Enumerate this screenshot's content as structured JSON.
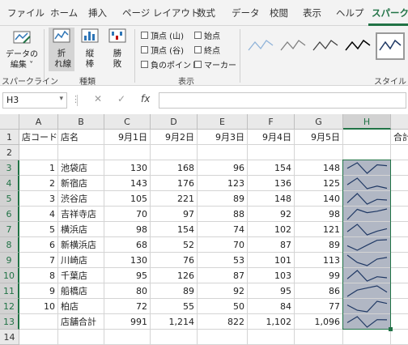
{
  "ribbon_tabs": [
    "ファイル",
    "ホーム",
    "挿入",
    "ページ レイアウト",
    "数式",
    "データ",
    "校閲",
    "表示",
    "ヘルプ",
    "スパークラ"
  ],
  "active_tab": "スパークラ",
  "ribbon": {
    "edit_data": "データの\n編集 ˅",
    "line": "折\n れ線",
    "column": "縦\n棒",
    "winloss": "勝\n敗",
    "group_sparkline": "スパークライン",
    "group_type": "種類",
    "group_show": "表示",
    "group_style": "スタイル",
    "checks": {
      "high": "頂点 (山)",
      "low": "頂点 (谷)",
      "negative": "負のポイント",
      "first": "始点",
      "last": "終点",
      "markers": "マーカー"
    }
  },
  "formula_bar": {
    "name_box": "H3",
    "fx": "fx",
    "value": ""
  },
  "col_headers": [
    "A",
    "B",
    "C",
    "D",
    "E",
    "F",
    "G",
    "H"
  ],
  "selected_col": "H",
  "row_headers": [
    "1",
    "2",
    "3",
    "4",
    "5",
    "6",
    "7",
    "8",
    "9",
    "10",
    "11",
    "12",
    "13",
    "14"
  ],
  "table": {
    "header": [
      "店コード",
      "店名",
      "9月1日",
      "9月2日",
      "9月3日",
      "9月4日",
      "9月5日",
      "",
      "合計"
    ],
    "rows": [
      {
        "code": "1",
        "name": "池袋店",
        "v": [
          "130",
          "168",
          "96",
          "154",
          "148"
        ]
      },
      {
        "code": "2",
        "name": "新宿店",
        "v": [
          "143",
          "176",
          "123",
          "136",
          "125"
        ]
      },
      {
        "code": "3",
        "name": "渋谷店",
        "v": [
          "105",
          "221",
          "89",
          "148",
          "140"
        ]
      },
      {
        "code": "4",
        "name": "吉祥寺店",
        "v": [
          "70",
          "97",
          "88",
          "92",
          "98"
        ]
      },
      {
        "code": "5",
        "name": "横浜店",
        "v": [
          "98",
          "154",
          "74",
          "102",
          "121"
        ]
      },
      {
        "code": "6",
        "name": "新横浜店",
        "v": [
          "68",
          "52",
          "70",
          "87",
          "89"
        ]
      },
      {
        "code": "7",
        "name": "川崎店",
        "v": [
          "130",
          "76",
          "53",
          "101",
          "113"
        ]
      },
      {
        "code": "8",
        "name": "千葉店",
        "v": [
          "95",
          "126",
          "87",
          "103",
          "99"
        ]
      },
      {
        "code": "9",
        "name": "船橋店",
        "v": [
          "80",
          "89",
          "92",
          "95",
          "86"
        ]
      },
      {
        "code": "10",
        "name": "柏店",
        "v": [
          "72",
          "55",
          "50",
          "84",
          "77"
        ]
      }
    ],
    "total": {
      "code": "",
      "name": "店舗合計",
      "v": [
        "991",
        "1,214",
        "822",
        "1,102",
        "1,096"
      ]
    }
  },
  "colors": {
    "accent": "#217346",
    "spark_fill": "#b1b7c4",
    "spark_line": "#1f3864"
  }
}
